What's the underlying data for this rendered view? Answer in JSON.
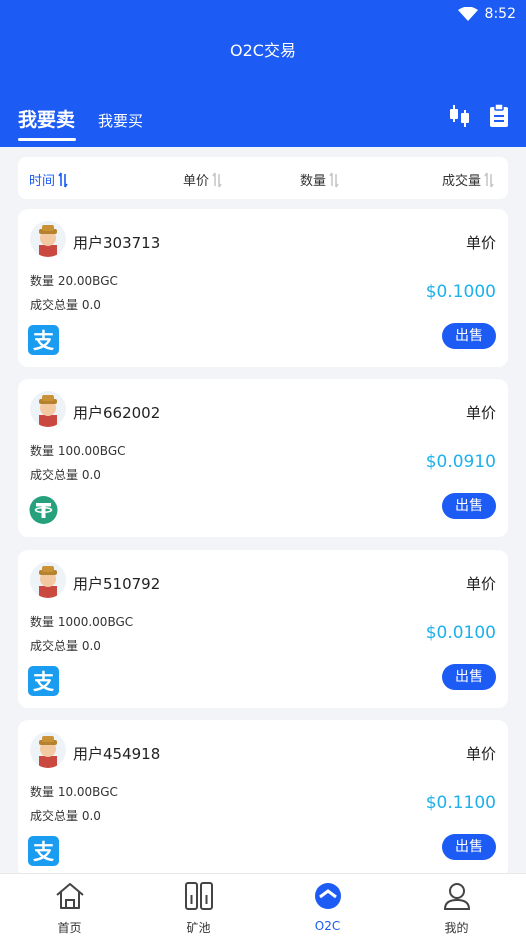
{
  "status": {
    "time": "8:52"
  },
  "header": {
    "title": "O2C交易"
  },
  "tabs": {
    "sell": "我要卖",
    "buy": "我要买"
  },
  "sort": {
    "time": "时间",
    "price": "单价",
    "qty": "数量",
    "volume": "成交量"
  },
  "colors": {
    "primary": "#1c5bf4",
    "price": "#1eb0ec",
    "alipay": "#1a9cf0",
    "usdt": "#26a17b"
  },
  "orders": [
    {
      "user": "用户303713",
      "price_label": "单价",
      "qty": "数量 20.00BGC",
      "total": "成交总量 0.0",
      "price": "$0.1000",
      "payment": "alipay-icon",
      "action": "出售"
    },
    {
      "user": "用户662002",
      "price_label": "单价",
      "qty": "数量 100.00BGC",
      "total": "成交总量 0.0",
      "price": "$0.0910",
      "payment": "usdt-icon",
      "action": "出售"
    },
    {
      "user": "用户510792",
      "price_label": "单价",
      "qty": "数量 1000.00BGC",
      "total": "成交总量 0.0",
      "price": "$0.0100",
      "payment": "alipay-icon",
      "action": "出售"
    },
    {
      "user": "用户454918",
      "price_label": "单价",
      "qty": "数量 10.00BGC",
      "total": "成交总量 0.0",
      "price": "$0.1100",
      "payment": "alipay-icon",
      "action": "出售"
    }
  ],
  "nav": [
    {
      "label": "首页",
      "icon": "home-icon"
    },
    {
      "label": "矿池",
      "icon": "pool-icon"
    },
    {
      "label": "O2C",
      "icon": "o2c-icon"
    },
    {
      "label": "我的",
      "icon": "profile-icon"
    }
  ]
}
